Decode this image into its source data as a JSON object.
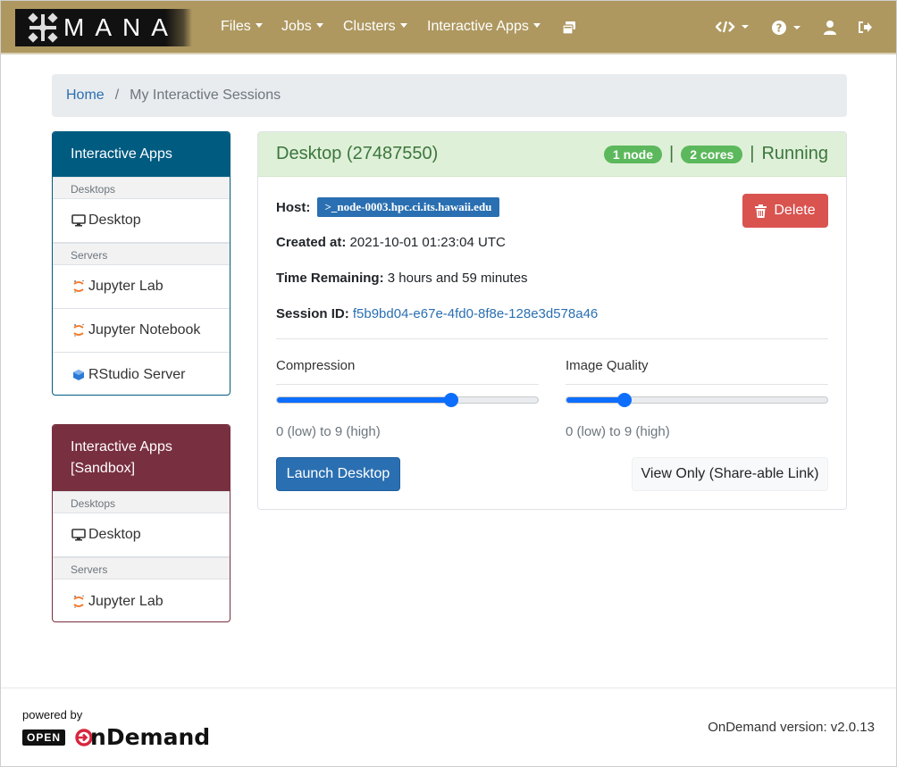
{
  "brand": {
    "name": "MANA"
  },
  "navbar": {
    "items": [
      {
        "label": "Files"
      },
      {
        "label": "Jobs"
      },
      {
        "label": "Clusters"
      },
      {
        "label": "Interactive Apps"
      }
    ],
    "icons": [
      "all-sessions-icon",
      "developer-icon",
      "help-icon",
      "user-icon",
      "logout-icon"
    ]
  },
  "breadcrumb": {
    "home": "Home",
    "separator": "/",
    "current": "My Interactive Sessions"
  },
  "sidebar": {
    "panel1": {
      "title": "Interactive Apps",
      "group1": "Desktops",
      "desktop": "Desktop",
      "group2": "Servers",
      "jupyter_lab": "Jupyter Lab",
      "jupyter_notebook": "Jupyter Notebook",
      "rstudio": "RStudio Server"
    },
    "panel2": {
      "title": "Interactive Apps [Sandbox]",
      "group1": "Desktops",
      "desktop": "Desktop",
      "group2": "Servers",
      "jupyter_lab": "Jupyter Lab"
    }
  },
  "session": {
    "title": "Desktop (27487550)",
    "nodes_badge": "1 node",
    "separator": "|",
    "cores_badge": "2 cores",
    "status": "Running",
    "host_label": "Host:",
    "host_value": "node-0003.hpc.ci.its.hawaii.edu",
    "created_label": "Created at:",
    "created_value": "2021-10-01 01:23:04 UTC",
    "remaining_label": "Time Remaining:",
    "remaining_value": "3 hours and 59 minutes",
    "session_id_label": "Session ID:",
    "session_id_value": "f5b9bd04-e67e-4fd0-8f8e-128e3d578a46",
    "delete_label": "Delete",
    "compression_label": "Compression",
    "compression_value": 6,
    "compression_hint": "0 (low) to 9 (high)",
    "quality_label": "Image Quality",
    "quality_value": 2,
    "quality_hint": "0 (low) to 9 (high)",
    "launch_label": "Launch Desktop",
    "view_only_label": "View Only (Share-able Link)"
  },
  "footer": {
    "powered_by": "powered by",
    "open_badge": "OPEN",
    "ondemand": "OnDemand",
    "version": "OnDemand version: v2.0.13"
  },
  "colors": {
    "navbar": "#ae9860",
    "panel1_header": "#005b81",
    "panel2_header": "#782f40",
    "success": "#5cb85c",
    "danger": "#d9534f",
    "primary": "#2a6fb1"
  }
}
